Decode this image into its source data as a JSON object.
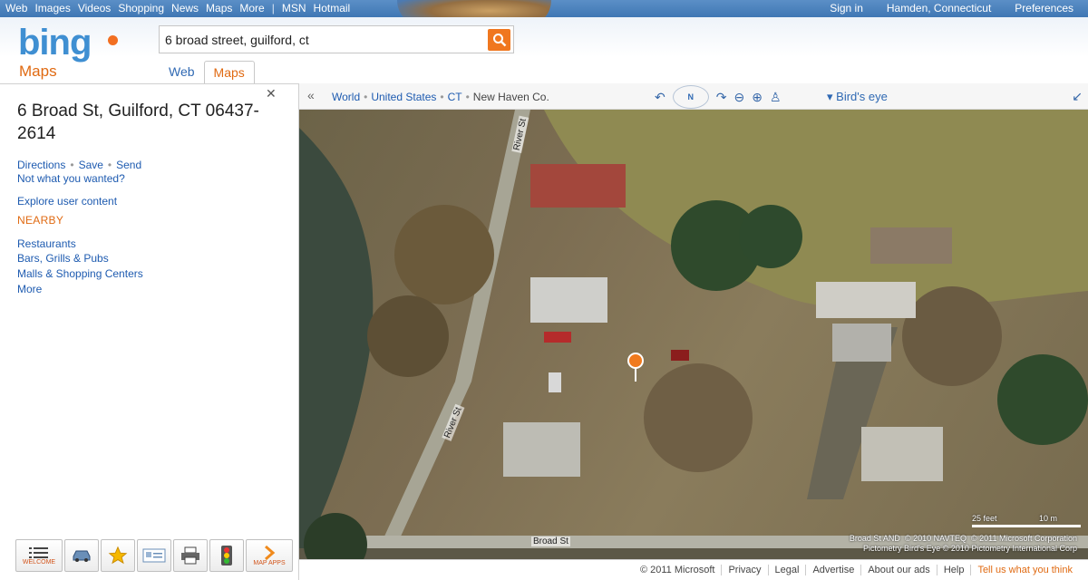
{
  "topnav": {
    "left": [
      "Web",
      "Images",
      "Videos",
      "Shopping",
      "News",
      "Maps",
      "More"
    ],
    "separator": "|",
    "left2": [
      "MSN",
      "Hotmail"
    ],
    "right": [
      "Sign in",
      "Hamden, Connecticut",
      "Preferences"
    ]
  },
  "brand": {
    "logo": "bing",
    "product": "Maps"
  },
  "search": {
    "value": "6 broad street, guilford, ct"
  },
  "tabs": [
    {
      "label": "Web",
      "active": false
    },
    {
      "label": "Maps",
      "active": true
    }
  ],
  "result": {
    "address": "6 Broad St, Guilford, CT 06437-2614",
    "actions": [
      "Directions",
      "Save",
      "Send"
    ],
    "not_what": "Not what you wanted?",
    "explore": "Explore user content",
    "nearby_heading": "NEARBY",
    "nearby": [
      "Restaurants",
      "Bars, Grills & Pubs",
      "Malls & Shopping Centers",
      "More"
    ]
  },
  "toolbar_bottom": [
    {
      "label": "WELCOME",
      "icon": "list-icon"
    },
    {
      "label": "",
      "icon": "car-icon"
    },
    {
      "label": "",
      "icon": "star-icon"
    },
    {
      "label": "",
      "icon": "card-icon"
    },
    {
      "label": "",
      "icon": "printer-icon"
    },
    {
      "label": "",
      "icon": "traffic-light-icon"
    },
    {
      "label": "MAP APPS",
      "icon": "chevron-right-icon"
    }
  ],
  "map": {
    "breadcrumb": [
      "World",
      "United States",
      "CT",
      "New Haven Co."
    ],
    "compass_label": "N",
    "view_mode": "Bird's eye",
    "road_labels": [
      "River St",
      "River St",
      "Broad St"
    ],
    "scale": {
      "feet": "25 feet",
      "meters": "10 m"
    },
    "copyright": [
      "Broad St",
      "AND",
      "© 2010 NAVTEQ",
      "© 2011 Microsoft Corporation",
      "Pictometry Bird's Eye © 2010 Pictometry International Corp"
    ]
  },
  "footer": [
    "© 2011 Microsoft",
    "Privacy",
    "Legal",
    "Advertise",
    "About our ads",
    "Help",
    "Tell us what you think"
  ],
  "colors": {
    "accent": "#e06a12",
    "link": "#1e5bb0",
    "topbar": "#3f77b4"
  }
}
